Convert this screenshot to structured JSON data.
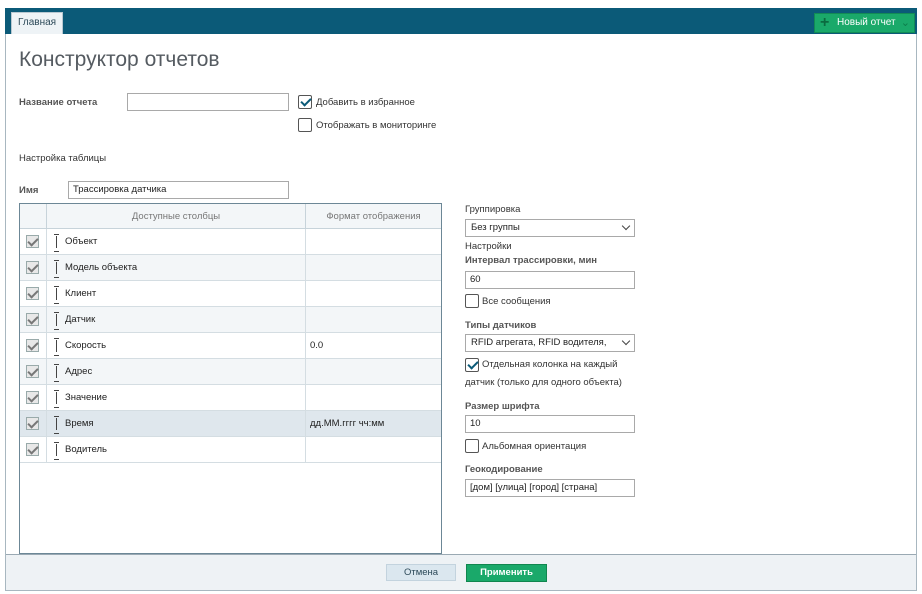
{
  "topbar": {
    "tab_home": "Главная",
    "new_report_label": "Новый отчет"
  },
  "page": {
    "title": "Конструктор отчетов"
  },
  "report": {
    "name_label": "Название отчета",
    "name_value": "",
    "favorites_label": "Добавить в избранное",
    "favorites_checked": true,
    "monitoring_label": "Отображать в мониторинге",
    "monitoring_checked": false
  },
  "table_settings": {
    "section_label": "Настройка таблицы",
    "name_label": "Имя",
    "name_value": "Трассировка датчика"
  },
  "grid": {
    "columns": [
      "Доступные столбцы",
      "Формат отображения"
    ],
    "rows": [
      {
        "name": "Объект",
        "format": "",
        "checked": true
      },
      {
        "name": "Модель объекта",
        "format": "",
        "checked": true
      },
      {
        "name": "Клиент",
        "format": "",
        "checked": true
      },
      {
        "name": "Датчик",
        "format": "",
        "checked": true
      },
      {
        "name": "Скорость",
        "format": "0.0",
        "checked": true
      },
      {
        "name": "Адрес",
        "format": "",
        "checked": true
      },
      {
        "name": "Значение",
        "format": "",
        "checked": true
      },
      {
        "name": "Время",
        "format": "дд.ММ.гггг чч:мм",
        "checked": true
      },
      {
        "name": "Водитель",
        "format": "",
        "checked": true
      }
    ]
  },
  "right_panel": {
    "grouping_label": "Группировка",
    "grouping_value": "Без группы",
    "settings_label": "Настройки",
    "interval_label": "Интервал трассировки, мин",
    "interval_value": "60",
    "all_messages_label": "Все сообщения",
    "all_messages_checked": false,
    "sensor_types_label": "Типы датчиков",
    "sensor_types_value": "RFID агрегата, RFID водителя,",
    "separate_column_line1": "Отдельная колонка на каждый",
    "separate_column_line2": "датчик (только для одного объекта)",
    "separate_column_checked": true,
    "font_size_label": "Размер шрифта",
    "font_size_value": "10",
    "landscape_label": "Альбомная ориентация",
    "landscape_checked": false,
    "geocoding_label": "Геокодирование",
    "geocoding_value": "[дом] [улица] [город] [страна]"
  },
  "footer": {
    "cancel_label": "Отмена",
    "apply_label": "Применить"
  }
}
